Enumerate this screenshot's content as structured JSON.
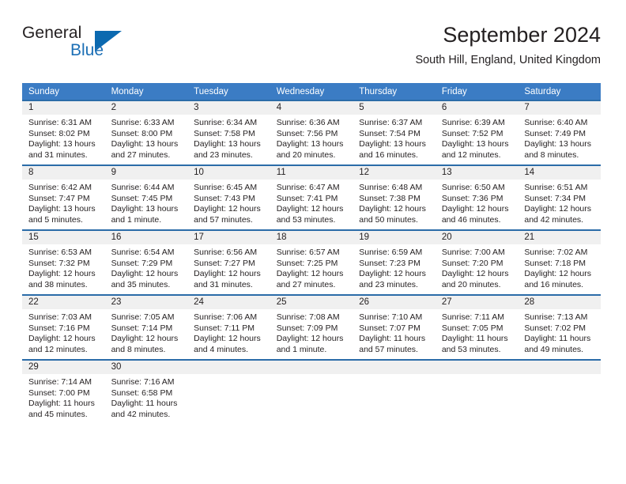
{
  "brand": {
    "name_part1": "General",
    "name_part2": "Blue",
    "triangle_color": "#0b69b0",
    "blue_text_color": "#1c6fb5"
  },
  "header": {
    "title": "September 2024",
    "subtitle": "South Hill, England, United Kingdom"
  },
  "colors": {
    "header_row_background": "#3b7cc4",
    "header_row_text": "#ffffff",
    "week_divider": "#2b6ca8",
    "daynum_background": "#f0f0f0",
    "body_text": "#231f20"
  },
  "weekday_headers": [
    "Sunday",
    "Monday",
    "Tuesday",
    "Wednesday",
    "Thursday",
    "Friday",
    "Saturday"
  ],
  "labels": {
    "sunrise_prefix": "Sunrise:",
    "sunset_prefix": "Sunset:",
    "daylight_prefix": "Daylight:"
  },
  "weeks": [
    [
      {
        "day": "1",
        "sunrise": "Sunrise: 6:31 AM",
        "sunset": "Sunset: 8:02 PM",
        "daylight_line1": "Daylight: 13 hours",
        "daylight_line2": "and 31 minutes."
      },
      {
        "day": "2",
        "sunrise": "Sunrise: 6:33 AM",
        "sunset": "Sunset: 8:00 PM",
        "daylight_line1": "Daylight: 13 hours",
        "daylight_line2": "and 27 minutes."
      },
      {
        "day": "3",
        "sunrise": "Sunrise: 6:34 AM",
        "sunset": "Sunset: 7:58 PM",
        "daylight_line1": "Daylight: 13 hours",
        "daylight_line2": "and 23 minutes."
      },
      {
        "day": "4",
        "sunrise": "Sunrise: 6:36 AM",
        "sunset": "Sunset: 7:56 PM",
        "daylight_line1": "Daylight: 13 hours",
        "daylight_line2": "and 20 minutes."
      },
      {
        "day": "5",
        "sunrise": "Sunrise: 6:37 AM",
        "sunset": "Sunset: 7:54 PM",
        "daylight_line1": "Daylight: 13 hours",
        "daylight_line2": "and 16 minutes."
      },
      {
        "day": "6",
        "sunrise": "Sunrise: 6:39 AM",
        "sunset": "Sunset: 7:52 PM",
        "daylight_line1": "Daylight: 13 hours",
        "daylight_line2": "and 12 minutes."
      },
      {
        "day": "7",
        "sunrise": "Sunrise: 6:40 AM",
        "sunset": "Sunset: 7:49 PM",
        "daylight_line1": "Daylight: 13 hours",
        "daylight_line2": "and 8 minutes."
      }
    ],
    [
      {
        "day": "8",
        "sunrise": "Sunrise: 6:42 AM",
        "sunset": "Sunset: 7:47 PM",
        "daylight_line1": "Daylight: 13 hours",
        "daylight_line2": "and 5 minutes."
      },
      {
        "day": "9",
        "sunrise": "Sunrise: 6:44 AM",
        "sunset": "Sunset: 7:45 PM",
        "daylight_line1": "Daylight: 13 hours",
        "daylight_line2": "and 1 minute."
      },
      {
        "day": "10",
        "sunrise": "Sunrise: 6:45 AM",
        "sunset": "Sunset: 7:43 PM",
        "daylight_line1": "Daylight: 12 hours",
        "daylight_line2": "and 57 minutes."
      },
      {
        "day": "11",
        "sunrise": "Sunrise: 6:47 AM",
        "sunset": "Sunset: 7:41 PM",
        "daylight_line1": "Daylight: 12 hours",
        "daylight_line2": "and 53 minutes."
      },
      {
        "day": "12",
        "sunrise": "Sunrise: 6:48 AM",
        "sunset": "Sunset: 7:38 PM",
        "daylight_line1": "Daylight: 12 hours",
        "daylight_line2": "and 50 minutes."
      },
      {
        "day": "13",
        "sunrise": "Sunrise: 6:50 AM",
        "sunset": "Sunset: 7:36 PM",
        "daylight_line1": "Daylight: 12 hours",
        "daylight_line2": "and 46 minutes."
      },
      {
        "day": "14",
        "sunrise": "Sunrise: 6:51 AM",
        "sunset": "Sunset: 7:34 PM",
        "daylight_line1": "Daylight: 12 hours",
        "daylight_line2": "and 42 minutes."
      }
    ],
    [
      {
        "day": "15",
        "sunrise": "Sunrise: 6:53 AM",
        "sunset": "Sunset: 7:32 PM",
        "daylight_line1": "Daylight: 12 hours",
        "daylight_line2": "and 38 minutes."
      },
      {
        "day": "16",
        "sunrise": "Sunrise: 6:54 AM",
        "sunset": "Sunset: 7:29 PM",
        "daylight_line1": "Daylight: 12 hours",
        "daylight_line2": "and 35 minutes."
      },
      {
        "day": "17",
        "sunrise": "Sunrise: 6:56 AM",
        "sunset": "Sunset: 7:27 PM",
        "daylight_line1": "Daylight: 12 hours",
        "daylight_line2": "and 31 minutes."
      },
      {
        "day": "18",
        "sunrise": "Sunrise: 6:57 AM",
        "sunset": "Sunset: 7:25 PM",
        "daylight_line1": "Daylight: 12 hours",
        "daylight_line2": "and 27 minutes."
      },
      {
        "day": "19",
        "sunrise": "Sunrise: 6:59 AM",
        "sunset": "Sunset: 7:23 PM",
        "daylight_line1": "Daylight: 12 hours",
        "daylight_line2": "and 23 minutes."
      },
      {
        "day": "20",
        "sunrise": "Sunrise: 7:00 AM",
        "sunset": "Sunset: 7:20 PM",
        "daylight_line1": "Daylight: 12 hours",
        "daylight_line2": "and 20 minutes."
      },
      {
        "day": "21",
        "sunrise": "Sunrise: 7:02 AM",
        "sunset": "Sunset: 7:18 PM",
        "daylight_line1": "Daylight: 12 hours",
        "daylight_line2": "and 16 minutes."
      }
    ],
    [
      {
        "day": "22",
        "sunrise": "Sunrise: 7:03 AM",
        "sunset": "Sunset: 7:16 PM",
        "daylight_line1": "Daylight: 12 hours",
        "daylight_line2": "and 12 minutes."
      },
      {
        "day": "23",
        "sunrise": "Sunrise: 7:05 AM",
        "sunset": "Sunset: 7:14 PM",
        "daylight_line1": "Daylight: 12 hours",
        "daylight_line2": "and 8 minutes."
      },
      {
        "day": "24",
        "sunrise": "Sunrise: 7:06 AM",
        "sunset": "Sunset: 7:11 PM",
        "daylight_line1": "Daylight: 12 hours",
        "daylight_line2": "and 4 minutes."
      },
      {
        "day": "25",
        "sunrise": "Sunrise: 7:08 AM",
        "sunset": "Sunset: 7:09 PM",
        "daylight_line1": "Daylight: 12 hours",
        "daylight_line2": "and 1 minute."
      },
      {
        "day": "26",
        "sunrise": "Sunrise: 7:10 AM",
        "sunset": "Sunset: 7:07 PM",
        "daylight_line1": "Daylight: 11 hours",
        "daylight_line2": "and 57 minutes."
      },
      {
        "day": "27",
        "sunrise": "Sunrise: 7:11 AM",
        "sunset": "Sunset: 7:05 PM",
        "daylight_line1": "Daylight: 11 hours",
        "daylight_line2": "and 53 minutes."
      },
      {
        "day": "28",
        "sunrise": "Sunrise: 7:13 AM",
        "sunset": "Sunset: 7:02 PM",
        "daylight_line1": "Daylight: 11 hours",
        "daylight_line2": "and 49 minutes."
      }
    ],
    [
      {
        "day": "29",
        "sunrise": "Sunrise: 7:14 AM",
        "sunset": "Sunset: 7:00 PM",
        "daylight_line1": "Daylight: 11 hours",
        "daylight_line2": "and 45 minutes."
      },
      {
        "day": "30",
        "sunrise": "Sunrise: 7:16 AM",
        "sunset": "Sunset: 6:58 PM",
        "daylight_line1": "Daylight: 11 hours",
        "daylight_line2": "and 42 minutes."
      },
      {
        "day": "",
        "sunrise": "",
        "sunset": "",
        "daylight_line1": "",
        "daylight_line2": ""
      },
      {
        "day": "",
        "sunrise": "",
        "sunset": "",
        "daylight_line1": "",
        "daylight_line2": ""
      },
      {
        "day": "",
        "sunrise": "",
        "sunset": "",
        "daylight_line1": "",
        "daylight_line2": ""
      },
      {
        "day": "",
        "sunrise": "",
        "sunset": "",
        "daylight_line1": "",
        "daylight_line2": ""
      },
      {
        "day": "",
        "sunrise": "",
        "sunset": "",
        "daylight_line1": "",
        "daylight_line2": ""
      }
    ]
  ]
}
